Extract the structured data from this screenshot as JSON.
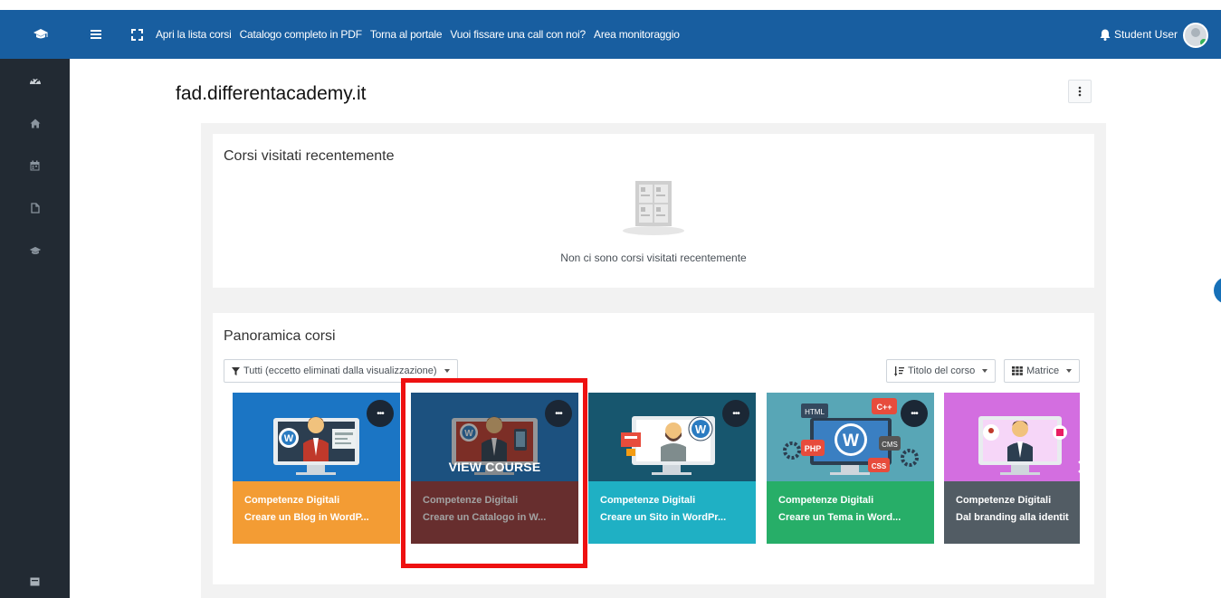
{
  "topbar": {
    "nav": [
      "Apri la lista corsi",
      "Catalogo completo in PDF",
      "Torna al portale",
      "Vuoi fissare una call con noi?",
      "Area monitoraggio"
    ],
    "user_name": "Student User"
  },
  "site_title": "fad.differentacademy.it",
  "recent": {
    "title": "Corsi visitati recentemente",
    "empty_text": "Non ci sono corsi visitati recentemente"
  },
  "overview": {
    "title": "Panoramica corsi",
    "filter_label": "Tutti (eccetto eliminati dalla visualizzazione)",
    "sort_label": "Titolo del corso",
    "view_label": "Matrice",
    "view_course_label": "VIEW COURSE",
    "courses": [
      {
        "category": "Competenze Digitali",
        "title": "Creare un Blog in WordP...",
        "color": "#f39c34"
      },
      {
        "category": "Competenze Digitali",
        "title": "Creare un Catalogo in W...",
        "color": "#9c3a3a"
      },
      {
        "category": "Competenze Digitali",
        "title": "Creare un Sito in WordPr...",
        "color": "#1fb0c4"
      },
      {
        "category": "Competenze Digitali",
        "title": "Creare un Tema in Word...",
        "color": "#27ae68"
      },
      {
        "category": "Competenze Digitali",
        "title": "Dal branding alla identit",
        "color": "#525c64"
      }
    ]
  },
  "colors": {
    "topbar": "#185ea0",
    "sidebar": "#222a33",
    "highlight": "#ee1111"
  }
}
